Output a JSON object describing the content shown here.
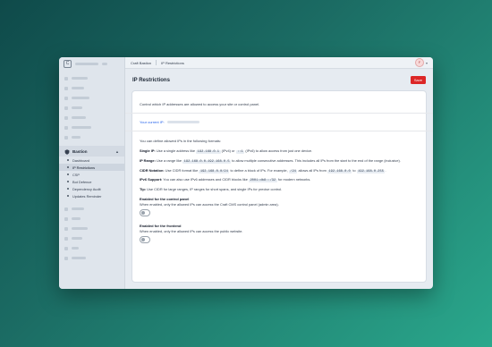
{
  "app": {
    "logo_letter": "C"
  },
  "sidebar": {
    "section_label": "Bastion",
    "items": [
      {
        "label": "Dashboard"
      },
      {
        "label": "IP Restrictions"
      },
      {
        "label": "CSP"
      },
      {
        "label": "Bot Defence"
      },
      {
        "label": "Dependency Audit"
      },
      {
        "label": "Updates Reminder"
      }
    ]
  },
  "breadcrumb": {
    "first": "Craft Bastion",
    "second": "IP Restrictions"
  },
  "user": {
    "initial": "F"
  },
  "page": {
    "title": "IP Restrictions",
    "save_label": "Save"
  },
  "content": {
    "intro": "Control which IP addresses are allowed to access your site or control panel.",
    "current_ip_label": "Your current IP:",
    "formats_lead": "You can define allowed IPs in the following formats:",
    "single_ip": {
      "title": "Single IP:",
      "t1": " Use a single address like ",
      "c1": "192.168.0.1",
      "t2": " (IPv4) or ",
      "c2": "::1",
      "t3": " (IPv6) to allow access from just one device."
    },
    "ip_range": {
      "title": "IP Range:",
      "t1": " Use a range like ",
      "c1": "192.168.0.0-192.168.0.5",
      "t2": " to allow multiple consecutive addresses. This includes all IPs from the start to the end of the range (inclusive)."
    },
    "cidr": {
      "title": "CIDR Notation:",
      "t1": " Use CIDR format like ",
      "c1": "192.168.0.0/24",
      "t2": " to define a block of IPs. For example, ",
      "c2": "/24",
      "t3": " allows all IPs from ",
      "c3": "192.168.0.0",
      "t4": " to ",
      "c4": "192.168.0.255",
      "t5": "."
    },
    "ipv6": {
      "title": "IPv6 Support:",
      "t1": " You can also use IPv6 addresses and CIDR blocks like ",
      "c1": "2001:db8::/32",
      "t2": " for modern networks."
    },
    "tip": {
      "title": "Tip:",
      "t1": " Use CIDR for large ranges, IP ranges for short spans, and single IPs for precise control."
    },
    "cp_toggle": {
      "title": "Enabled for the control panel",
      "desc": "When enabled, only the allowed IPs can access the Craft CMS control panel (admin area).",
      "enabled": false
    },
    "fe_toggle": {
      "title": "Enabled for the frontend",
      "desc": "When enabled, only the allowed IPs can access the public website.",
      "enabled": false
    }
  }
}
